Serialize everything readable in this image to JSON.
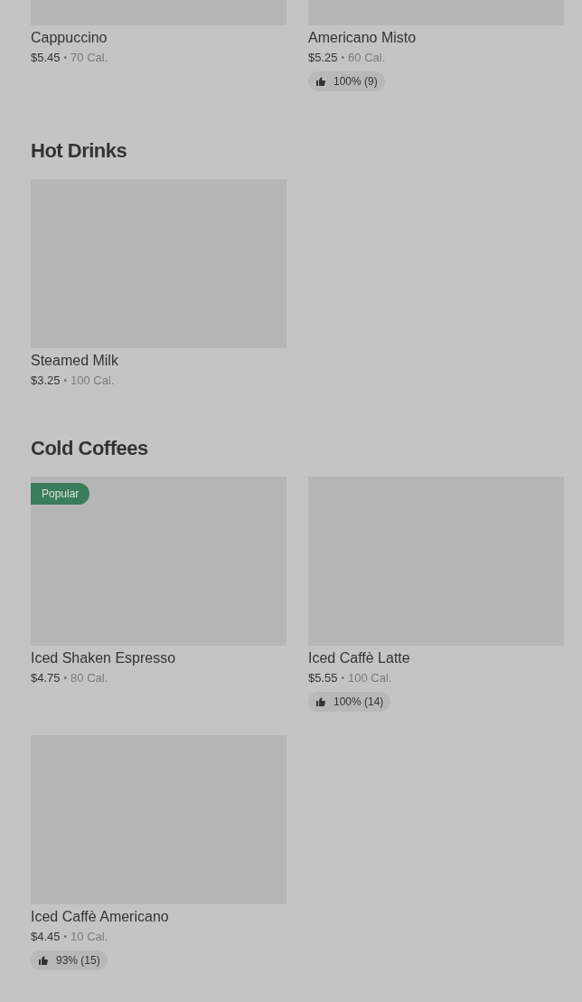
{
  "sections": [
    {
      "items": [
        {
          "name": "Cappuccino",
          "price": "$5.45",
          "separator": "•",
          "calories": "70 Cal."
        },
        {
          "name": "Americano Misto",
          "price": "$5.25",
          "separator": "•",
          "calories": "60 Cal.",
          "rating": "100% (9)"
        }
      ]
    },
    {
      "title": "Hot Drinks",
      "items": [
        {
          "name": "Steamed Milk",
          "price": "$3.25",
          "separator": "•",
          "calories": "100 Cal."
        }
      ]
    },
    {
      "title": "Cold Coffees",
      "items": [
        {
          "name": "Iced Shaken Espresso",
          "price": "$4.75",
          "separator": "•",
          "calories": "80 Cal.",
          "tag": "Popular"
        },
        {
          "name": "Iced Caffè Latte",
          "price": "$5.55",
          "separator": "•",
          "calories": "100 Cal.",
          "rating": "100% (14)"
        },
        {
          "name": "Iced Caffè Americano",
          "price": "$4.45",
          "separator": "•",
          "calories": "10 Cal.",
          "rating": "93% (15)"
        }
      ]
    }
  ]
}
